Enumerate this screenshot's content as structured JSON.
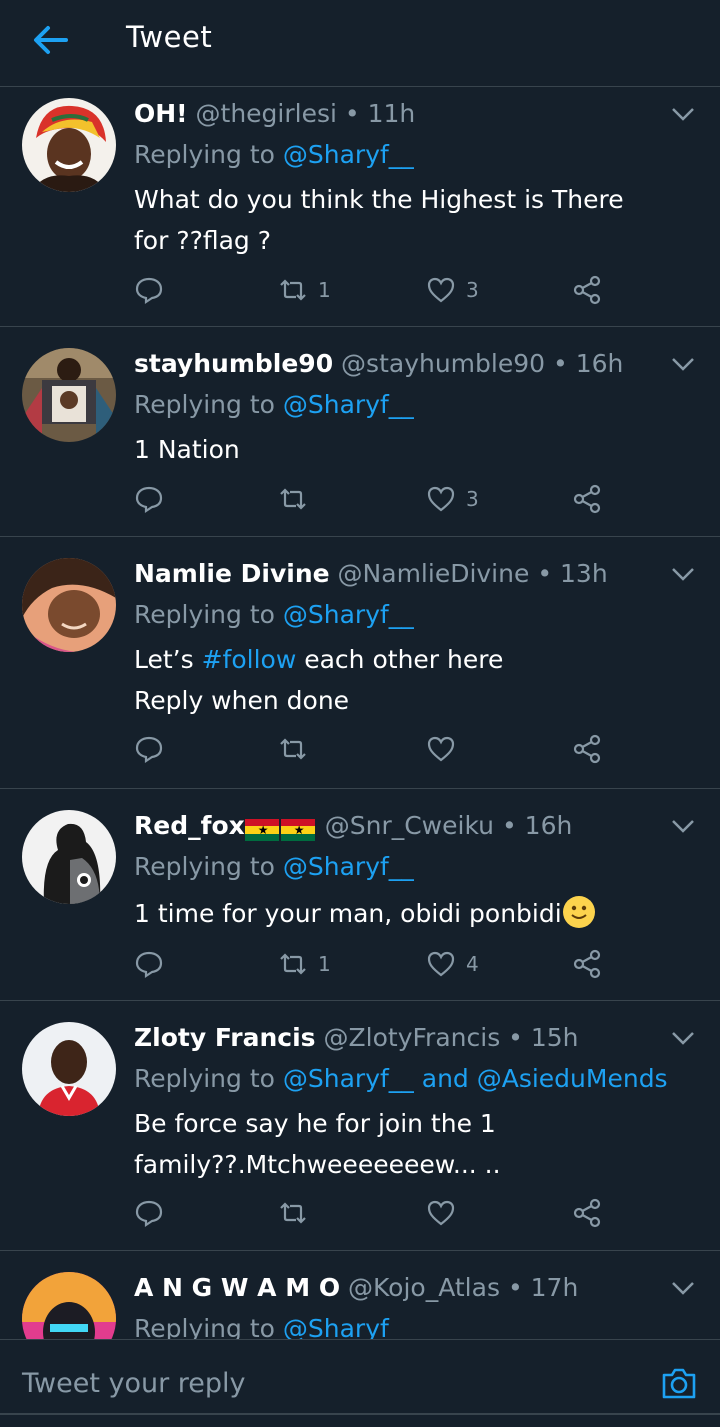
{
  "header": {
    "title": "Tweet",
    "back_icon": "arrow-left-icon"
  },
  "colors": {
    "background": "#15202b",
    "accent": "#1da1f2",
    "muted": "#8899a6",
    "divider": "#38444d"
  },
  "tweets": [
    {
      "name": "OH!",
      "handle": "@thegirlesi",
      "dot": "•",
      "time": "11h",
      "replying_prefix": "Replying to ",
      "replying_to": "@Sharyf__",
      "lines": [
        "What do you think the Highest is There",
        "for ??flag ?"
      ],
      "retweets": "1",
      "likes": "3"
    },
    {
      "name": "stayhumble90",
      "handle": "@stayhumble90",
      "dot": "•",
      "time": "16h",
      "replying_prefix": "Replying to ",
      "replying_to": "@Sharyf__",
      "lines": [
        "1 Nation"
      ],
      "retweets": "",
      "likes": "3"
    },
    {
      "name": "Namlie Divine",
      "handle": "@NamlieDivine",
      "dot": "•",
      "time": "13h",
      "replying_prefix": "Replying to ",
      "replying_to": "@Sharyf__",
      "line1_prefix": "Let’s ",
      "hashtag": "#follow",
      "line1_suffix": " each other here",
      "line2": "Reply when done",
      "retweets": "",
      "likes": ""
    },
    {
      "name": "Red_fox",
      "handle": "@Snr_Cweiku",
      "dot": "•",
      "time": "16h",
      "name_emoji": "ghana-flag-icon x2",
      "replying_prefix": "Replying to ",
      "replying_to": "@Sharyf__",
      "lines": [
        "1 time for your man, obidi ponbidi"
      ],
      "text_emoji": "slightly-smiling-face-icon",
      "retweets": "1",
      "likes": "4"
    },
    {
      "name": "Zloty Francis",
      "handle": "@ZlotyFrancis",
      "dot": "•",
      "time": "15h",
      "replying_prefix": "Replying to ",
      "replying_to": "@Sharyf__ and @AsieduMends",
      "lines": [
        "Be force say he for join the 1",
        "family??.Mtchweeeeeeew... .."
      ],
      "retweets": "",
      "likes": ""
    },
    {
      "name": "A N G W A M O",
      "handle": "@Kojo_Atlas",
      "dot": "•",
      "time": "17h",
      "replying_prefix": "Replying to ",
      "replying_to": "@Sharyf"
    }
  ],
  "composer": {
    "placeholder": "Tweet your reply",
    "camera_icon": "camera-icon"
  }
}
